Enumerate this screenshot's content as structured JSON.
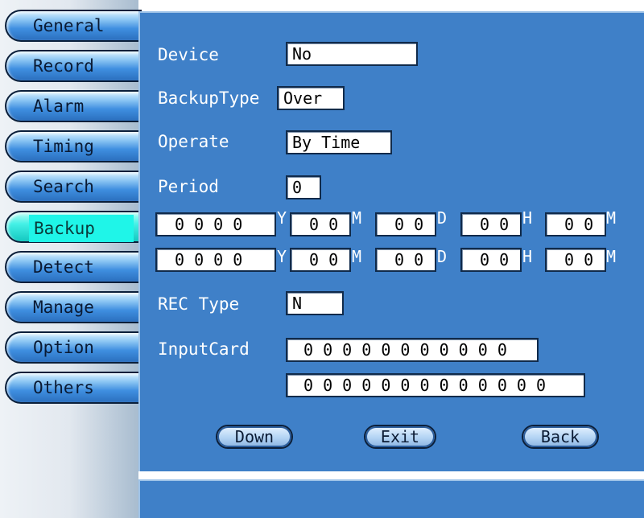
{
  "nav": {
    "items": [
      {
        "label": "General"
      },
      {
        "label": "Record"
      },
      {
        "label": "Alarm"
      },
      {
        "label": "Timing"
      },
      {
        "label": "Search"
      },
      {
        "label": "Backup",
        "active": true
      },
      {
        "label": "Detect"
      },
      {
        "label": "Manage"
      },
      {
        "label": "Option"
      },
      {
        "label": "Others"
      }
    ]
  },
  "form": {
    "device": {
      "label": "Device",
      "value": "No"
    },
    "backup_type": {
      "label": "BackupType",
      "value": "Over"
    },
    "operate": {
      "label": "Operate",
      "value": "By Time"
    },
    "period": {
      "label": "Period",
      "value": "0"
    },
    "start": {
      "year": "0 0 0 0",
      "month": "0 0",
      "day": "0 0",
      "hour": "0 0",
      "minute": "0 0"
    },
    "end": {
      "year": "0 0 0 0",
      "month": "0 0",
      "day": "0 0",
      "hour": "0 0",
      "minute": "0 0"
    },
    "units": {
      "year": "Y",
      "month": "M",
      "day": "D",
      "hour": "H",
      "minute": "M"
    },
    "rec_type": {
      "label": "REC Type",
      "value": "N"
    },
    "input_card": {
      "label": "InputCard",
      "value1": "0 0 0 0 0 0 0 0 0 0 0",
      "value2": "0 0 0 0 0 0 0 0 0 0 0 0 0"
    }
  },
  "buttons": {
    "down": "Down",
    "exit": "Exit",
    "back": "Back"
  },
  "colors": {
    "panel": "#3f80c8",
    "active_tab": "#1ff5e8"
  }
}
